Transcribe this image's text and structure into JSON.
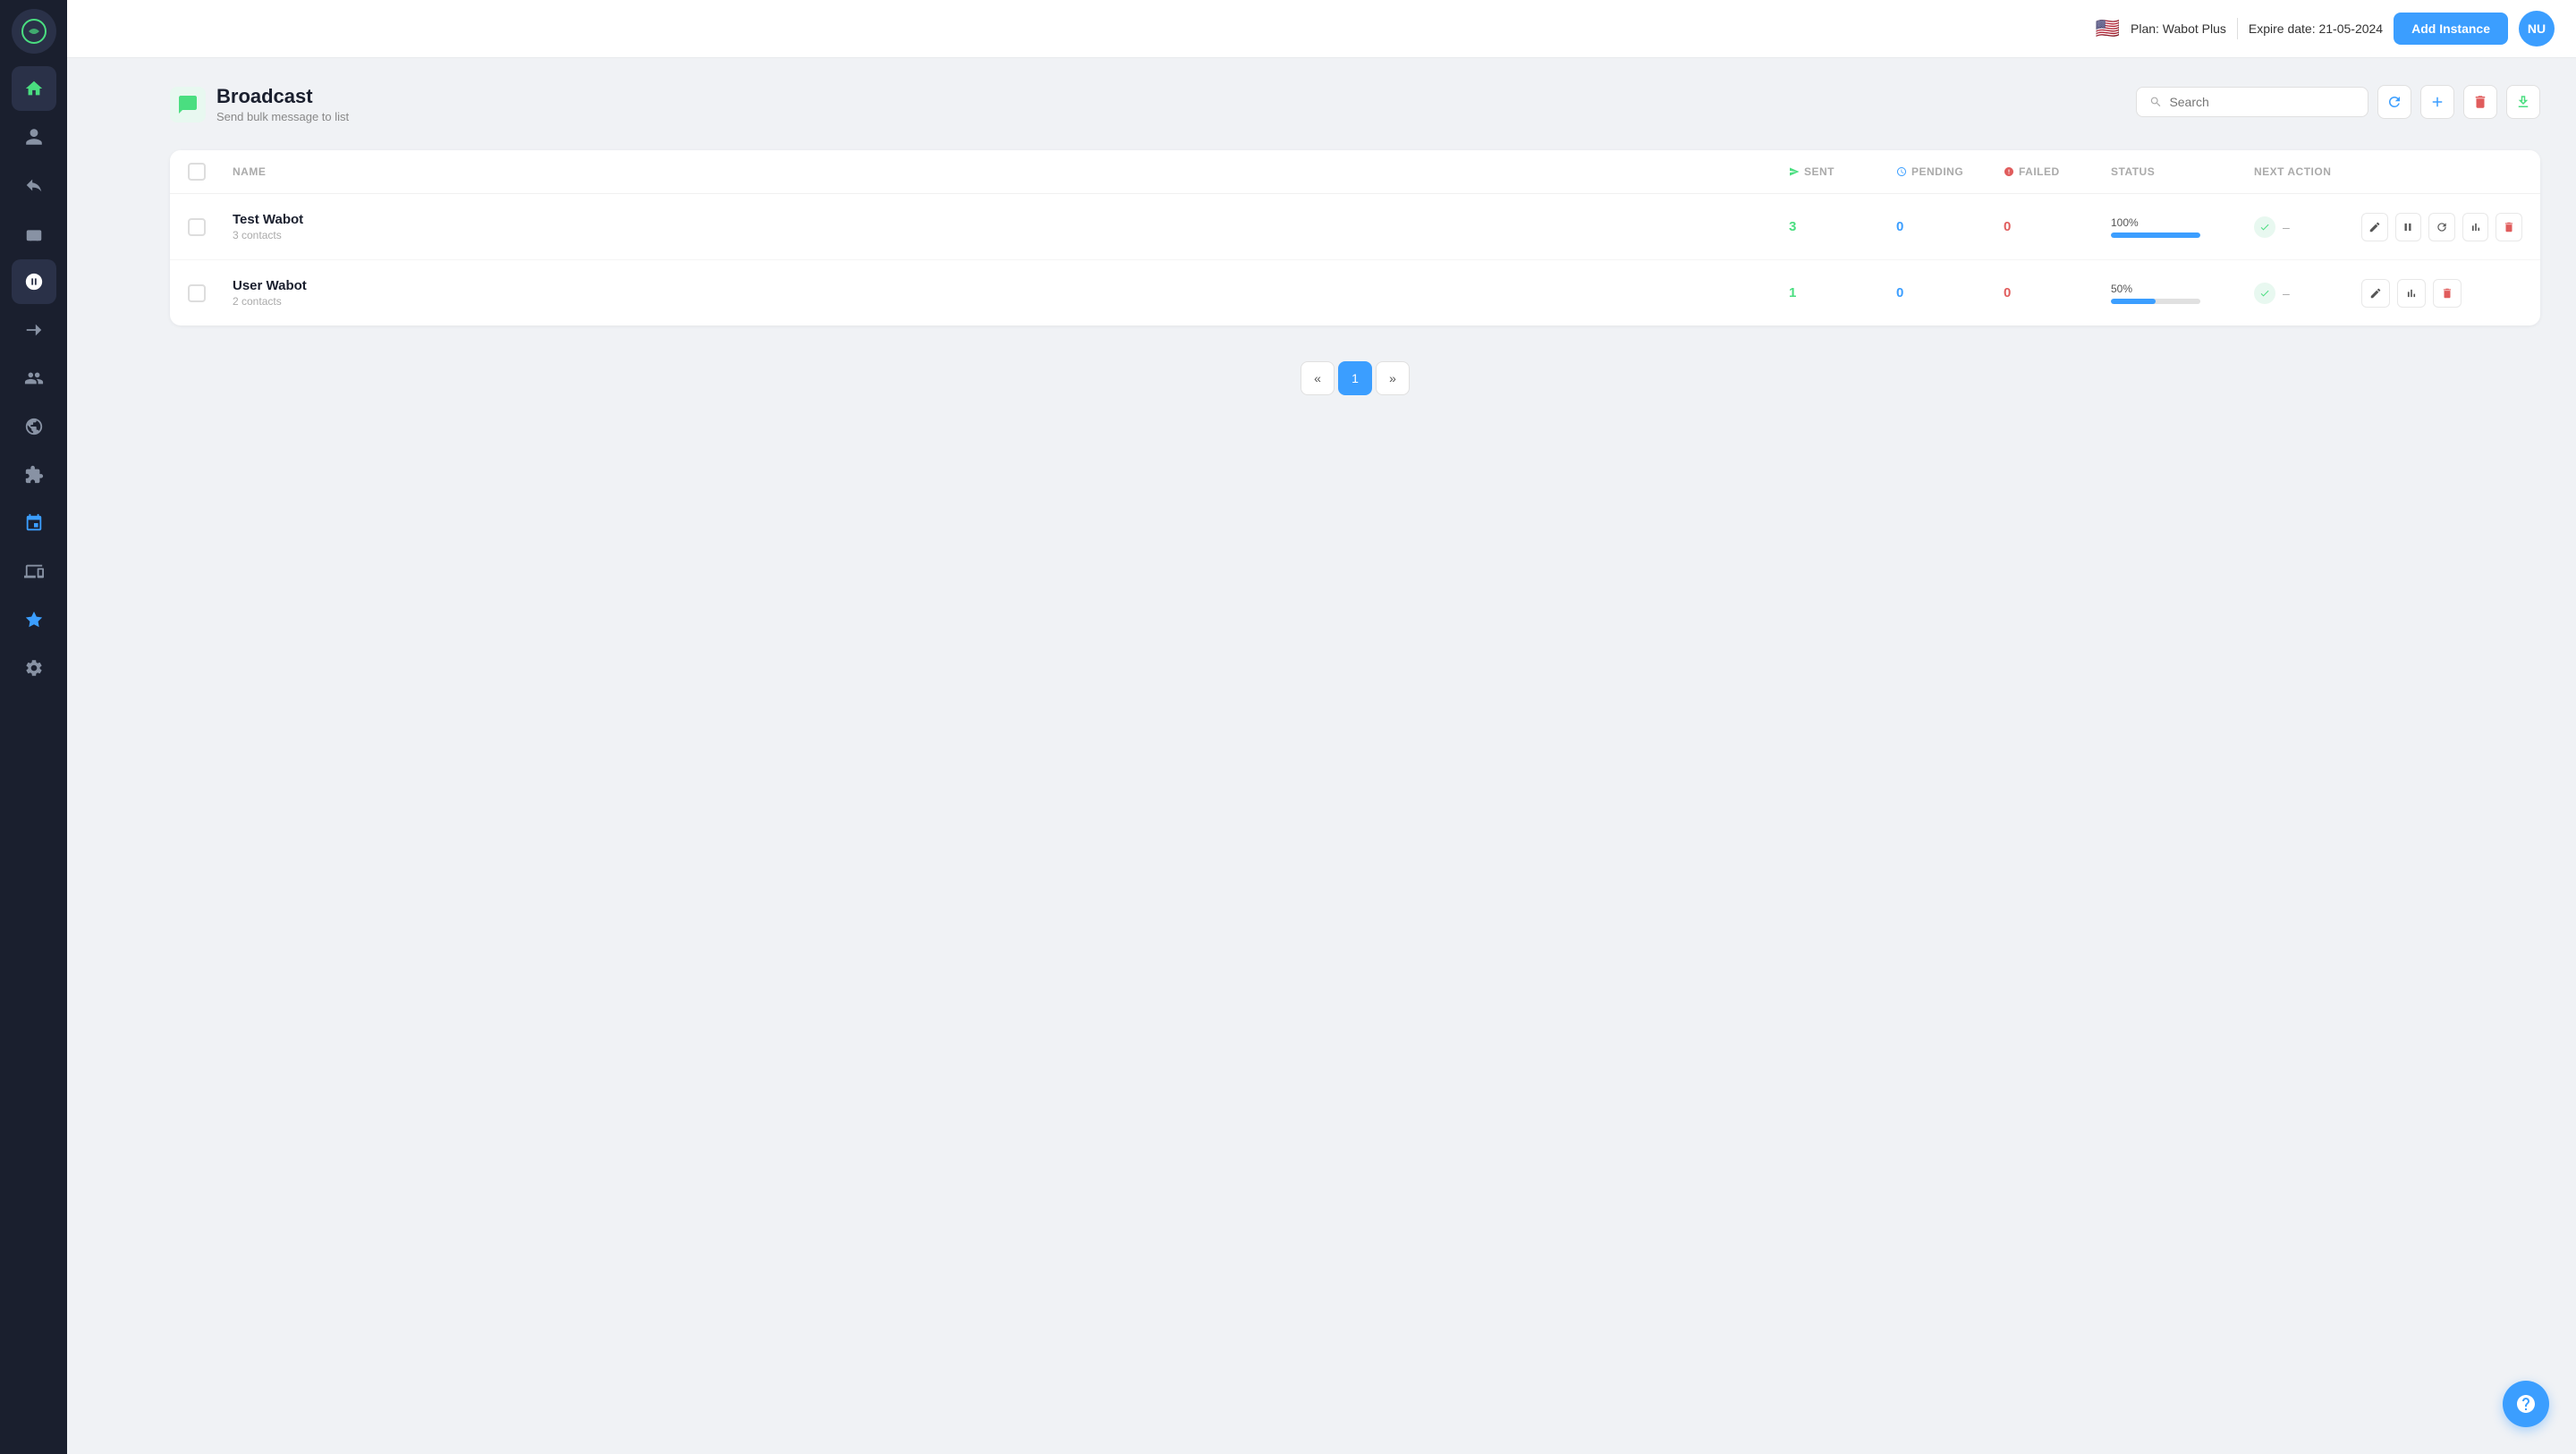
{
  "topbar": {
    "flag": "🇺🇸",
    "plan_label": "Plan: Wabot Plus",
    "expire_label": "Expire date: 21-05-2024",
    "add_instance_label": "Add Instance",
    "avatar_initials": "NU"
  },
  "page": {
    "title": "Broadcast",
    "subtitle": "Send bulk message to list",
    "icon": "💬"
  },
  "toolbar": {
    "search_placeholder": "Search",
    "refresh_icon": "↻",
    "add_icon": "+",
    "delete_icon": "🗑",
    "export_icon": "↧"
  },
  "table": {
    "columns": {
      "name": "NAME",
      "sent": "SENT",
      "pending": "PENDING",
      "failed": "FAILED",
      "status": "STATUS",
      "next_action": "NEXT ACTION"
    },
    "rows": [
      {
        "id": 1,
        "name": "Test Wabot",
        "contacts": "3 contacts",
        "sent": "3",
        "pending": "0",
        "failed": "0",
        "progress": "100%",
        "progress_value": 100,
        "status_dash": "–"
      },
      {
        "id": 2,
        "name": "User Wabot",
        "contacts": "2 contacts",
        "sent": "1",
        "pending": "0",
        "failed": "0",
        "progress": "50%",
        "progress_value": 50,
        "status_dash": "–"
      }
    ]
  },
  "pagination": {
    "prev": "«",
    "current": "1",
    "next": "»"
  },
  "sidebar": {
    "items": [
      {
        "icon": "🏠",
        "name": "home",
        "label": "Home"
      },
      {
        "icon": "👤",
        "name": "contacts",
        "label": "Contacts"
      },
      {
        "icon": "↩",
        "name": "replies",
        "label": "Replies"
      },
      {
        "icon": "🤖",
        "name": "bot",
        "label": "Bot"
      },
      {
        "icon": "💬",
        "name": "broadcast",
        "label": "Broadcast"
      },
      {
        "icon": "➡",
        "name": "forward",
        "label": "Forward"
      },
      {
        "icon": "👥",
        "name": "groups",
        "label": "Groups"
      },
      {
        "icon": "👨‍👩‍👧",
        "name": "team",
        "label": "Team"
      },
      {
        "icon": "🔌",
        "name": "plugins",
        "label": "Plugins"
      },
      {
        "icon": "🔗",
        "name": "integrations",
        "label": "Integrations"
      },
      {
        "icon": "📱",
        "name": "devices",
        "label": "Devices"
      },
      {
        "icon": "💎",
        "name": "premium",
        "label": "Premium"
      },
      {
        "icon": "🔧",
        "name": "settings",
        "label": "Settings"
      }
    ]
  }
}
